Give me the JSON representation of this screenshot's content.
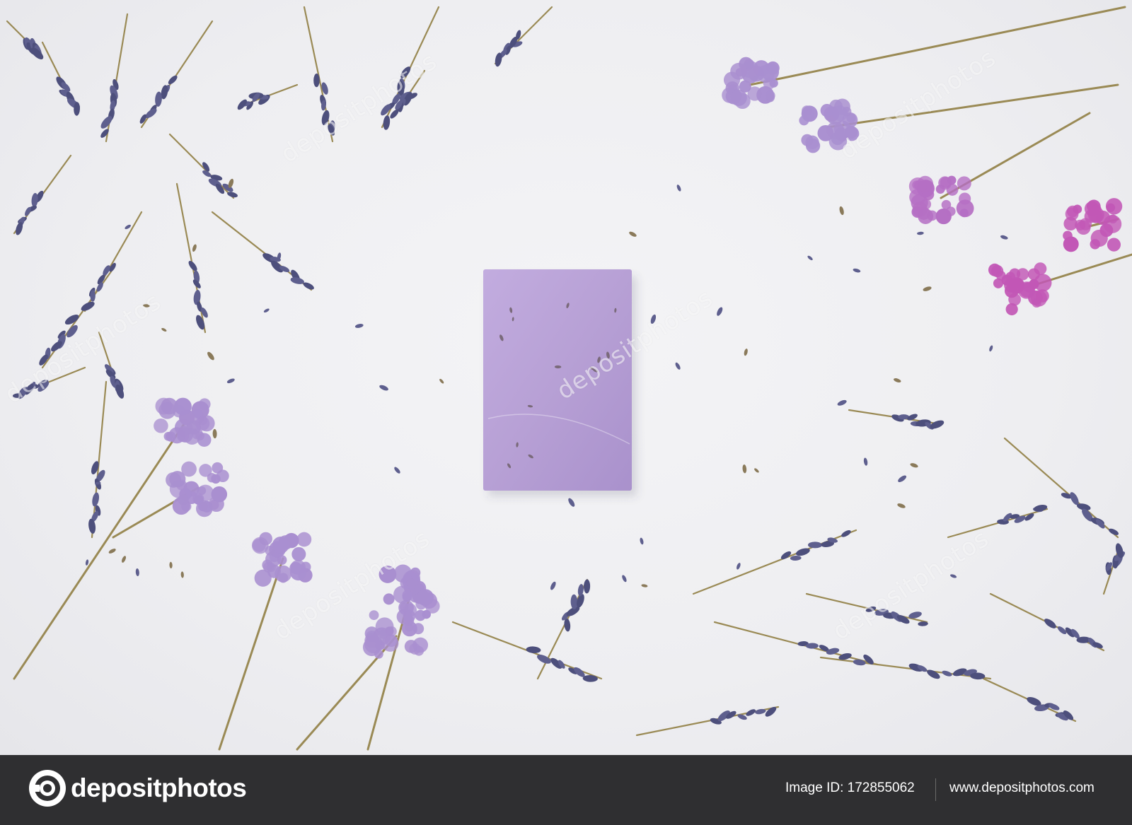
{
  "photo": {
    "watermark": "depositphotos",
    "colors": {
      "background": "#efeff2",
      "soap": "#b9a1d6",
      "lavender": "#5e5f8e",
      "statice_light": "#a98fd0",
      "statice_pink": "#c257b6",
      "stem": "#9a8a55"
    }
  },
  "footer": {
    "brand_name": "depositphotos",
    "brand_icon": "camera-shutter-icon",
    "image_id_label": "Image ID: 172855062",
    "site_url": "www.depositphotos.com"
  }
}
